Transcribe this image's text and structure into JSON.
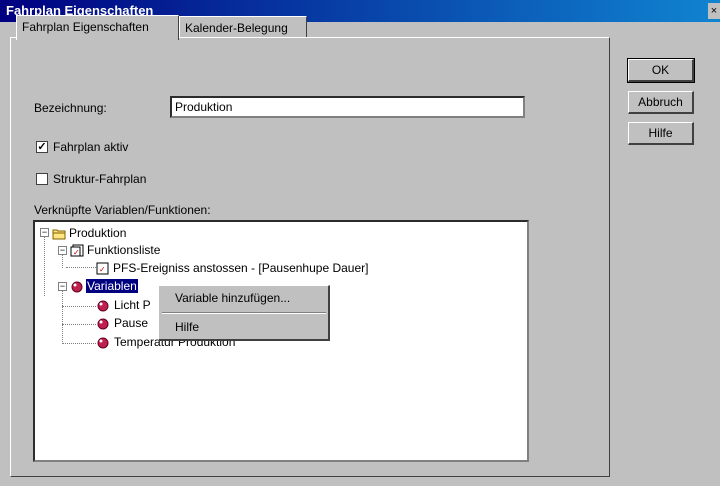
{
  "window": {
    "title": "Fahrplan Eigenschaften",
    "close_glyph": "×"
  },
  "tabs": [
    {
      "label": "Fahrplan Eigenschaften"
    },
    {
      "label": "Kalender-Belegung"
    }
  ],
  "form": {
    "bezeichnung_label": "Bezeichnung:",
    "bezeichnung_value": "Produktion",
    "fahrplan_aktiv_label": "Fahrplan aktiv",
    "fahrplan_aktiv_checked": true,
    "struktur_label": "Struktur-Fahrplan",
    "struktur_checked": false,
    "verknuepft_label": "Verknüpfte Variablen/Funktionen:"
  },
  "buttons": {
    "ok": "OK",
    "abbruch": "Abbruch",
    "hilfe": "Hilfe"
  },
  "tree": {
    "root": {
      "label": "Produktion",
      "icon": "folder-icon"
    },
    "funktionsliste": {
      "label": "Funktionsliste",
      "icon": "function-list-icon"
    },
    "ereignis": {
      "label": "PFS-Ereigniss anstossen - [Pausenhupe Dauer]",
      "icon": "event-icon"
    },
    "variablen": {
      "label": "Variablen",
      "icon": "variable-icon"
    },
    "var1": {
      "label": "Licht P",
      "icon": "variable-icon"
    },
    "var2": {
      "label": "Pause",
      "icon": "variable-icon"
    },
    "var3": {
      "label": "Temperatur Produktion",
      "icon": "variable-icon"
    }
  },
  "context_menu": {
    "items": [
      {
        "label": "Variable hinzufügen..."
      },
      {
        "label": "Hilfe"
      }
    ]
  },
  "colors": {
    "title_start": "#000080",
    "title_end": "#1084d0",
    "face": "#c0c0c0",
    "selection": "#000080"
  }
}
